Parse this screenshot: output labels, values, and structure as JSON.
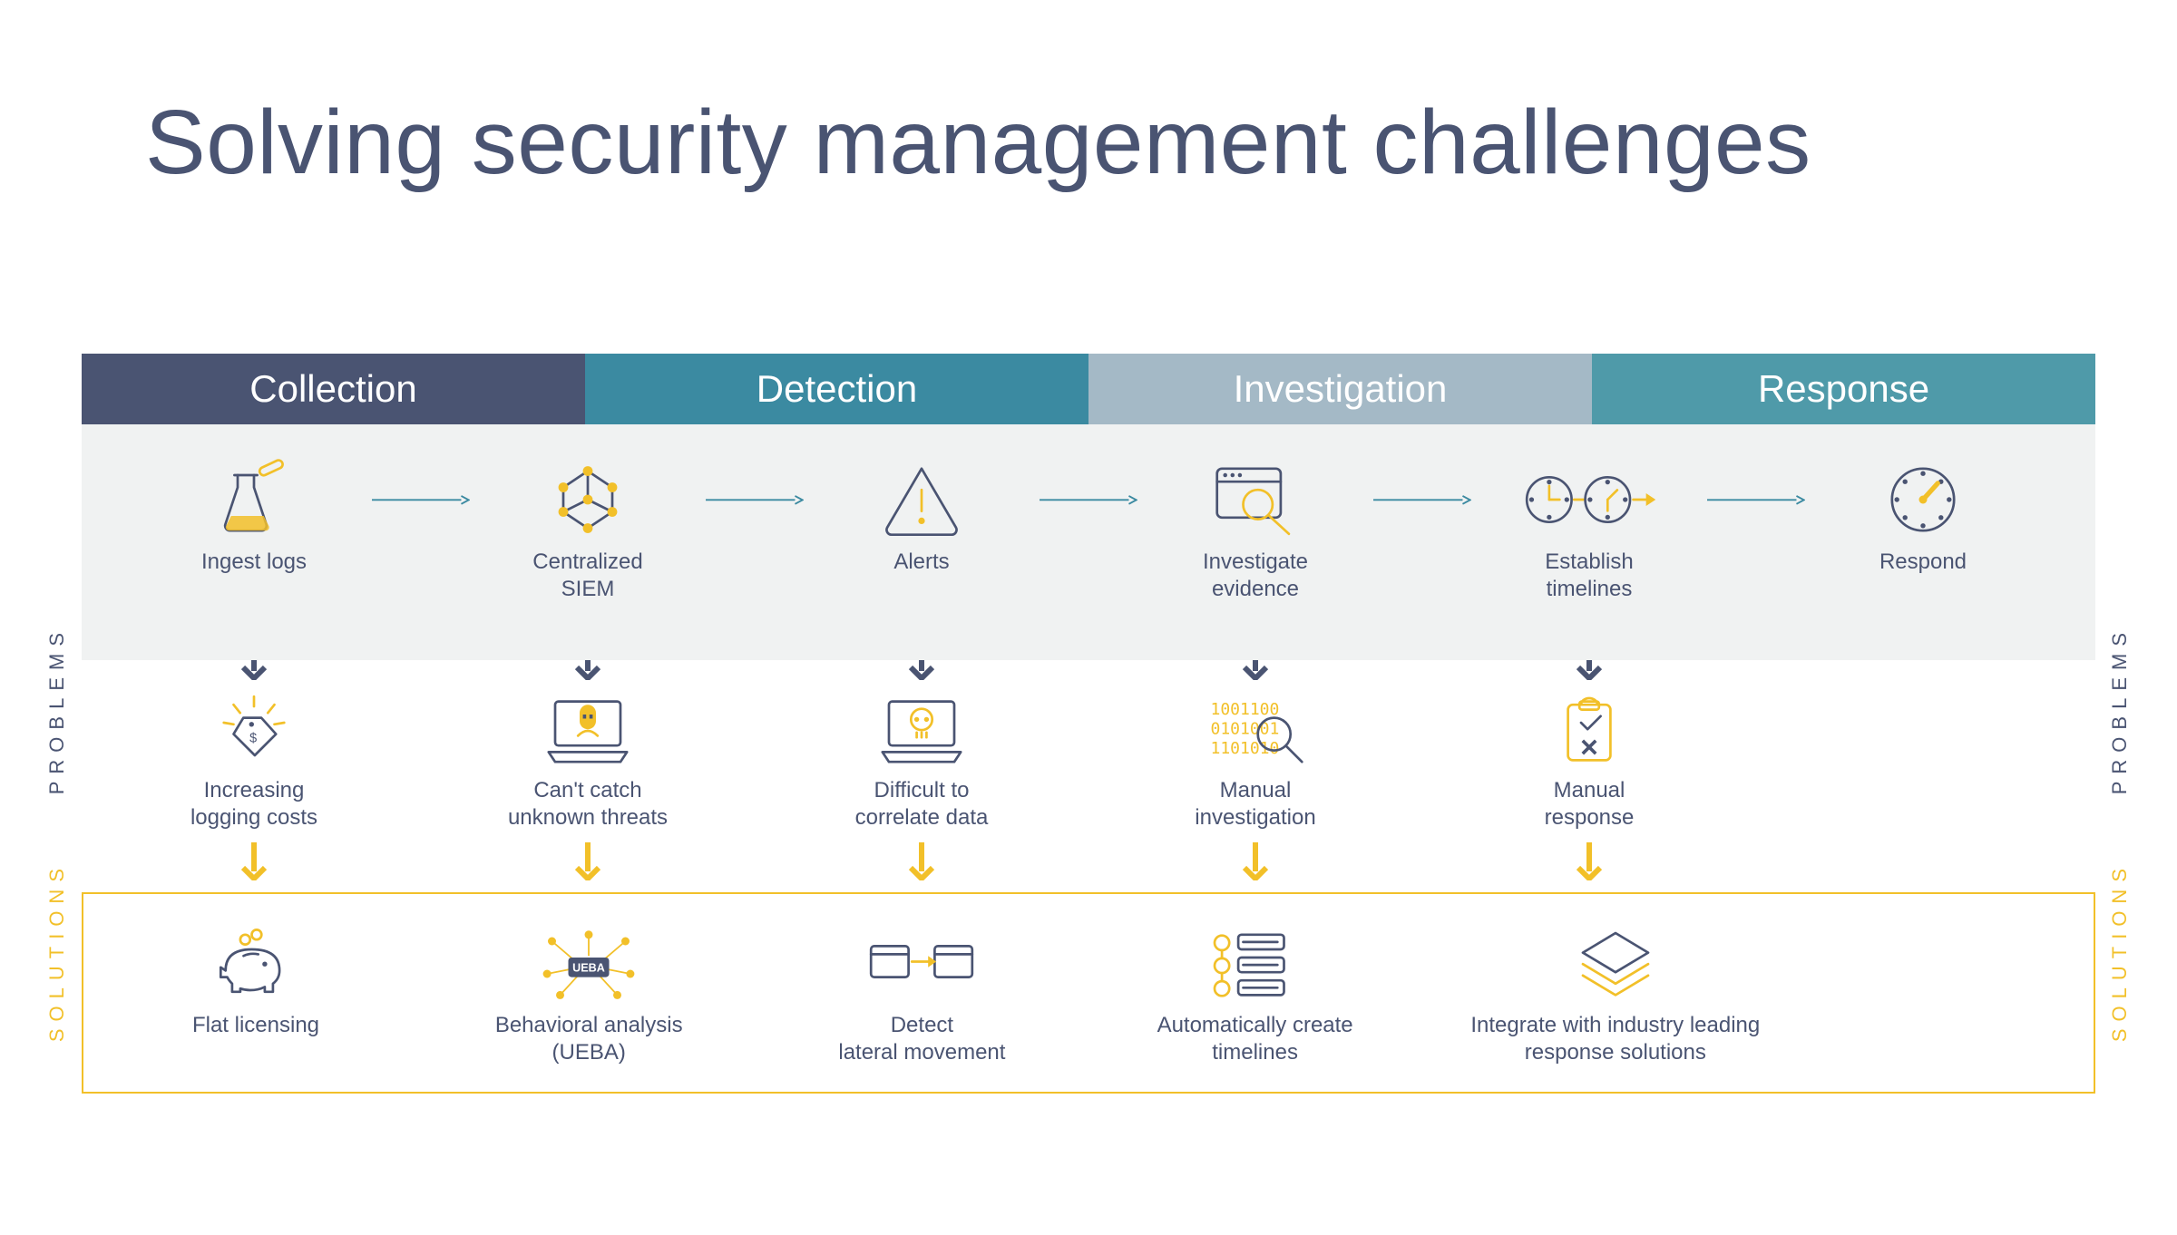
{
  "title": "Solving security management challenges",
  "phases": {
    "collection": "Collection",
    "detection": "Detection",
    "investigation": "Investigation",
    "response": "Response"
  },
  "flow": {
    "ingest": {
      "label": "Ingest logs",
      "icon": "flask-icon"
    },
    "siem": {
      "label": "Centralized\nSIEM",
      "icon": "molecule-icon"
    },
    "alerts": {
      "label": "Alerts",
      "icon": "warning-icon"
    },
    "evidence": {
      "label": "Investigate\nevidence",
      "icon": "browser-search-icon"
    },
    "timeline": {
      "label": "Establish\ntimelines",
      "icon": "clocks-icon"
    },
    "respond": {
      "label": "Respond",
      "icon": "gauge-icon"
    }
  },
  "problems_label": "PROBLEMS",
  "solutions_label": "SOLUTIONS",
  "problems": {
    "cost": {
      "label": "Increasing\nlogging costs",
      "icon": "price-tag-icon"
    },
    "catch": {
      "label": "Can't catch\nunknown threats",
      "icon": "laptop-hacker-icon"
    },
    "corr": {
      "label": "Difficult to\ncorrelate data",
      "icon": "laptop-skull-icon"
    },
    "manual": {
      "label": "Manual\ninvestigation",
      "icon": "binary-search-icon"
    },
    "resp": {
      "label": "Manual\nresponse",
      "icon": "clipboard-x-icon"
    }
  },
  "solutions": {
    "flat": {
      "label": "Flat licensing",
      "icon": "piggy-bank-icon"
    },
    "ueba": {
      "label": "Behavioral analysis\n(UEBA)",
      "icon": "ueba-icon",
      "badge": "UEBA"
    },
    "lat": {
      "label": "Detect\nlateral movement",
      "icon": "windows-sync-icon"
    },
    "auto": {
      "label": "Automatically create\ntimelines",
      "icon": "timeline-list-icon"
    },
    "integ": {
      "label": "Integrate with industry leading\nresponse solutions",
      "icon": "layers-icon"
    }
  },
  "colors": {
    "navy": "#4a5472",
    "teal_dark": "#3b8aa1",
    "teal_light": "#a4b9c6",
    "teal_mid": "#4f9aa9",
    "yellow": "#f2c029",
    "grey_bg": "#f0f2f2"
  }
}
